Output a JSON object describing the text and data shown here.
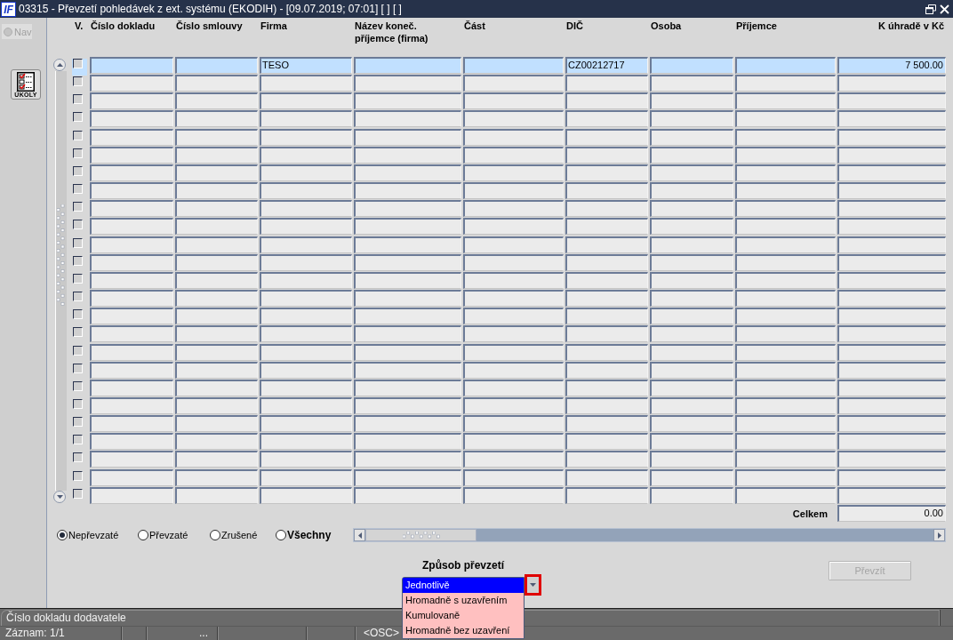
{
  "window": {
    "logo": "IF",
    "title": "03315 - Převzetí pohledávek z ext. systému (EKODIH) - [09.07.2019; 07:01] [ ] [ ]"
  },
  "nav": {
    "label": "Nav",
    "selected": false,
    "disabled": true
  },
  "tools": [
    {
      "label": "ÚKOLY"
    }
  ],
  "table": {
    "check_column": "V.",
    "columns": [
      {
        "label": "Číslo dokladu",
        "kind": "text"
      },
      {
        "label": "Číslo smlouvy",
        "kind": "text"
      },
      {
        "label": "Firma",
        "kind": "text"
      },
      {
        "label": "Název koneč.\npříjemce (firma)",
        "kind": "text"
      },
      {
        "label": "Část",
        "kind": "text"
      },
      {
        "label": "DIČ",
        "kind": "text"
      },
      {
        "label": "Osoba",
        "kind": "text"
      },
      {
        "label": "Příjemce",
        "kind": "text"
      },
      {
        "label": "K úhradě v Kč",
        "kind": "amount"
      }
    ],
    "rows": [
      {
        "selected": true,
        "checked": false,
        "cells": [
          null,
          null,
          "TESO",
          null,
          null,
          "CZ00212717",
          null,
          null,
          "7 500.00"
        ]
      },
      {
        "selected": false,
        "checked": false
      },
      {
        "selected": false,
        "checked": false
      },
      {
        "selected": false,
        "checked": false
      },
      {
        "selected": false,
        "checked": false
      },
      {
        "selected": false,
        "checked": false
      },
      {
        "selected": false,
        "checked": false
      },
      {
        "selected": false,
        "checked": false
      },
      {
        "selected": false,
        "checked": false
      },
      {
        "selected": false,
        "checked": false
      },
      {
        "selected": false,
        "checked": false
      },
      {
        "selected": false,
        "checked": false
      },
      {
        "selected": false,
        "checked": false
      },
      {
        "selected": false,
        "checked": false
      },
      {
        "selected": false,
        "checked": false
      },
      {
        "selected": false,
        "checked": false
      },
      {
        "selected": false,
        "checked": false
      },
      {
        "selected": false,
        "checked": false
      },
      {
        "selected": false,
        "checked": false
      },
      {
        "selected": false,
        "checked": false
      },
      {
        "selected": false,
        "checked": false
      },
      {
        "selected": false,
        "checked": false
      },
      {
        "selected": false,
        "checked": false
      },
      {
        "selected": false,
        "checked": false
      },
      {
        "selected": false,
        "checked": false
      }
    ],
    "total": {
      "label": "Celkem",
      "value": "0.00"
    }
  },
  "filter": [
    {
      "label": "Nepřevzaté",
      "selected": true,
      "bold": false
    },
    {
      "label": "Převzaté",
      "selected": false,
      "bold": false
    },
    {
      "label": "Zrušené",
      "selected": false,
      "bold": false
    },
    {
      "label": "Všechny",
      "selected": false,
      "bold": true
    }
  ],
  "method": {
    "label": "Způsob převzetí",
    "expanded": true,
    "highlighted": true,
    "options": [
      {
        "label": "Jednotlivě",
        "selected": true
      },
      {
        "label": "Hromadně s uzavřením",
        "selected": false
      },
      {
        "label": "Kumulovaně",
        "selected": false
      },
      {
        "label": "Hromadně bez uzavření",
        "selected": false
      }
    ]
  },
  "take_over_button": {
    "label": "Převzít",
    "disabled": true
  },
  "status_bar": {
    "message": "Číslo dokladu dodavatele",
    "record": "Záznam: 1/1",
    "more": "...",
    "mode": "<OSC>"
  }
}
